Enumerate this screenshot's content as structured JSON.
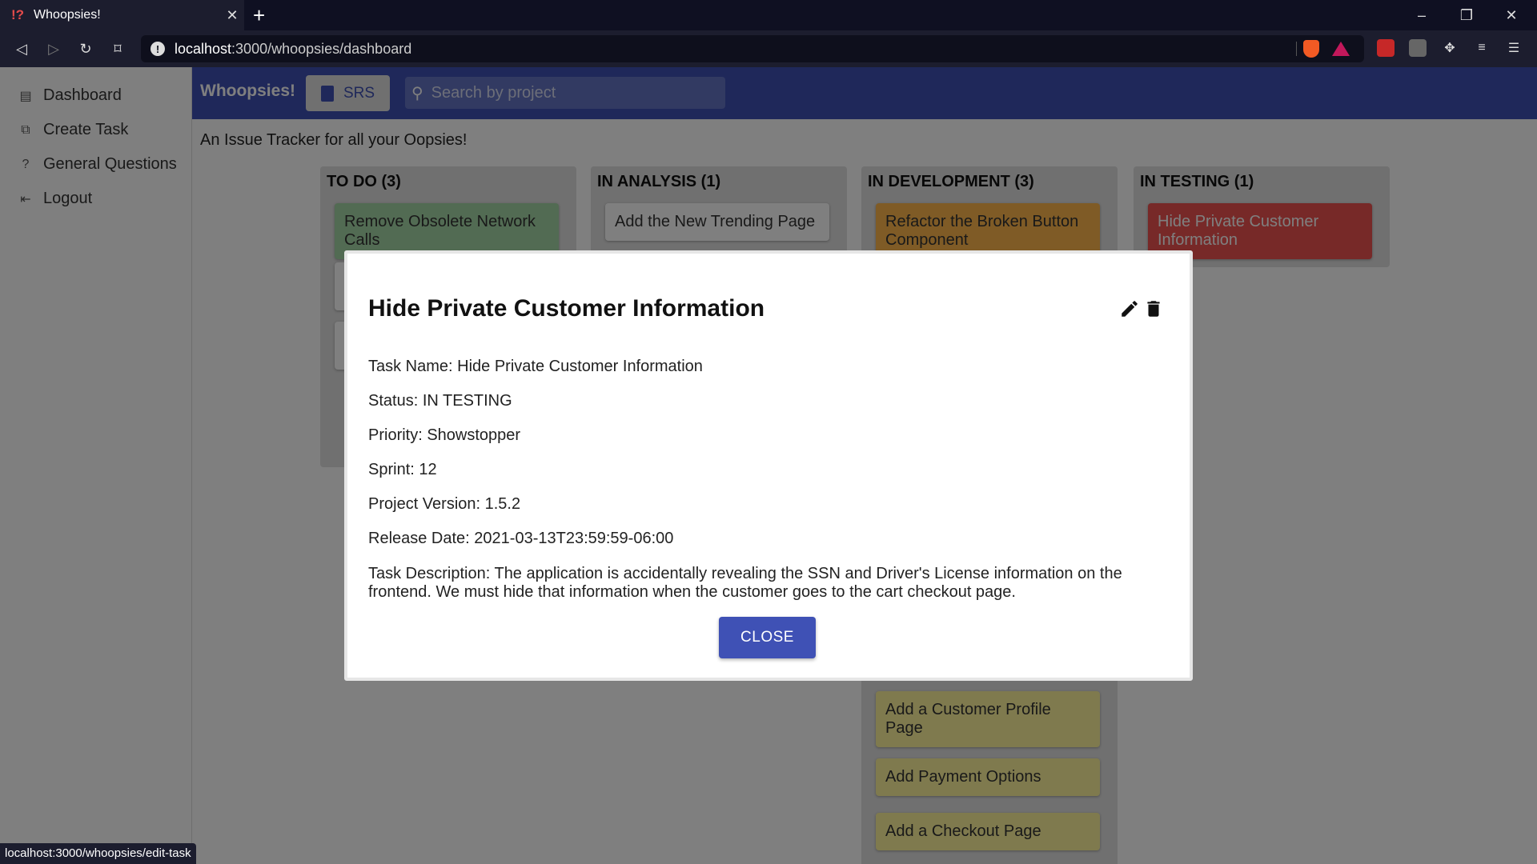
{
  "browser": {
    "tab_title": "Whoopsies!",
    "favicon": "!?",
    "url_host": "localhost",
    "url_path": ":3000/whoopsies/dashboard",
    "status_url": "localhost:3000/whoopsies/edit-task"
  },
  "sidebar": {
    "items": [
      {
        "label": "Dashboard",
        "icon": "list-icon"
      },
      {
        "label": "Create Task",
        "icon": "library-add-icon"
      },
      {
        "label": "General Questions",
        "icon": "help-icon"
      },
      {
        "label": "Logout",
        "icon": "exit-icon"
      }
    ]
  },
  "appbar": {
    "brand": "Whoopsies!",
    "srs_label": "SRS",
    "search_placeholder": "Search by project"
  },
  "subtitle": "An Issue Tracker for all your Oopsies!",
  "board": {
    "columns": [
      {
        "title": "TO DO (3)",
        "cards": [
          {
            "title": "Remove Obsolete Network Calls",
            "color": "#a5d6a7"
          }
        ]
      },
      {
        "title": "IN ANALYSIS (1)",
        "cards": [
          {
            "title": "Add the New Trending Page",
            "color": "#ffffff"
          }
        ]
      },
      {
        "title": "IN DEVELOPMENT (3)",
        "cards": [
          {
            "title": "Refactor the Broken Button Component",
            "color": "#ffb74d"
          },
          {
            "title": "Add a Customer Profile Page",
            "color": "#fff59d"
          },
          {
            "title": "Add Payment Options",
            "color": "#fff59d"
          },
          {
            "title": "Add a Checkout Page",
            "color": "#fff59d"
          }
        ]
      },
      {
        "title": "IN TESTING (1)",
        "cards": [
          {
            "title": "Hide Private Customer Information",
            "color": "#ef5350"
          }
        ]
      }
    ]
  },
  "modal": {
    "title": "Hide Private Customer Information",
    "task_name": "Task Name: Hide Private Customer Information",
    "status": "Status: IN TESTING",
    "priority": "Priority: Showstopper",
    "sprint": "Sprint: 12",
    "project_version": "Project Version: 1.5.2",
    "release_date": "Release Date: 2021-03-13T23:59:59-06:00",
    "description": "Task Description: The application is accidentally revealing the SSN and Driver's License information on the frontend. We must hide that information when the customer goes to the cart checkout page.",
    "close_label": "CLOSE"
  },
  "colors": {
    "primary": "#3f51b5",
    "overlay": "rgba(0,0,0,0.5)"
  }
}
